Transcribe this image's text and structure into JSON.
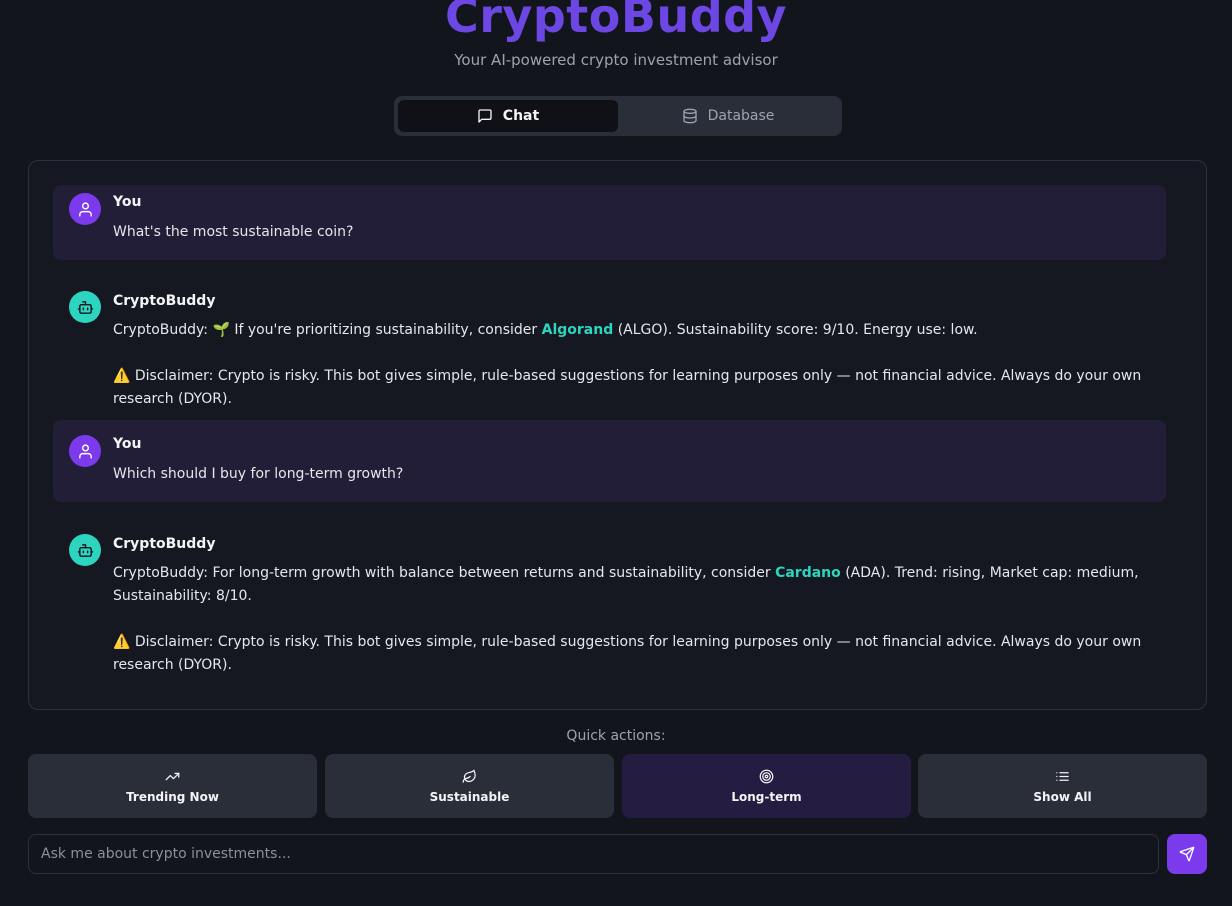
{
  "app": {
    "title": "CryptoBuddy",
    "subtitle": "Your AI-powered crypto investment advisor"
  },
  "tabs": [
    {
      "label": "Chat",
      "icon": "chat-icon",
      "active": true
    },
    {
      "label": "Database",
      "icon": "database-icon",
      "active": false
    }
  ],
  "messages": [
    {
      "role": "user",
      "sender": "You",
      "text": "What's the most sustainable coin?"
    },
    {
      "role": "bot",
      "sender": "CryptoBuddy",
      "text_before": "CryptoBuddy: 🌱 If you're prioritizing sustainability, consider ",
      "coin": "Algorand",
      "text_after": " (ALGO). Sustainability score: 9/10. Energy use: low.",
      "disclaimer": "⚠️ Disclaimer: Crypto is risky. This bot gives simple, rule-based suggestions for learning purposes only — not financial advice. Always do your own research (DYOR)."
    },
    {
      "role": "user",
      "sender": "You",
      "text": "Which should I buy for long-term growth?"
    },
    {
      "role": "bot",
      "sender": "CryptoBuddy",
      "text_before": "CryptoBuddy: For long-term growth with balance between returns and sustainability, consider ",
      "coin": "Cardano",
      "text_after": " (ADA). Trend: rising, Market cap: medium, Sustainability: 8/10.",
      "disclaimer": "⚠️ Disclaimer: Crypto is risky. This bot gives simple, rule-based suggestions for learning purposes only — not financial advice. Always do your own research (DYOR)."
    }
  ],
  "quick_actions": {
    "label": "Quick actions:",
    "items": [
      {
        "label": "Trending Now",
        "icon": "trending-up-icon",
        "active": false
      },
      {
        "label": "Sustainable",
        "icon": "leaf-icon",
        "active": false
      },
      {
        "label": "Long-term",
        "icon": "target-icon",
        "active": true
      },
      {
        "label": "Show All",
        "icon": "list-icon",
        "active": false
      }
    ]
  },
  "input": {
    "placeholder": "Ask me about crypto investments...",
    "value": ""
  },
  "colors": {
    "brand": "#6d47e3",
    "accent": "#7c3aed",
    "coin_highlight": "#2dd4bf"
  }
}
